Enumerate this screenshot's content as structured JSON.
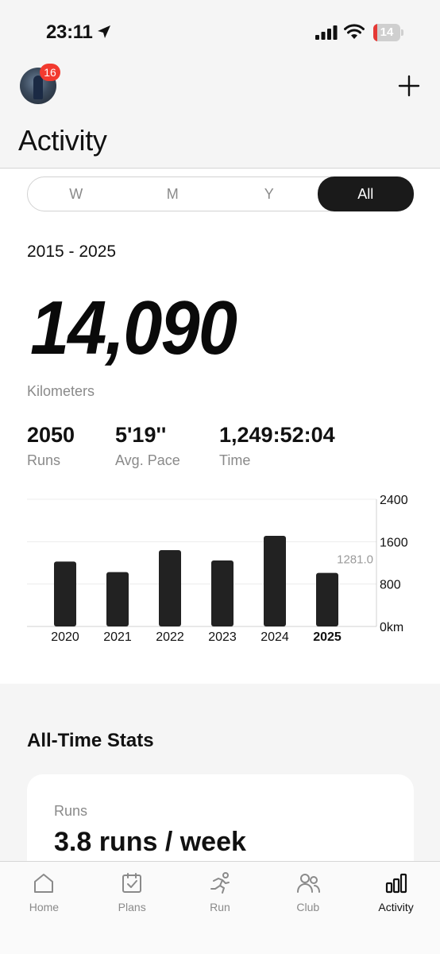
{
  "status": {
    "time": "23:11",
    "battery": "14",
    "battery_level": 0.14
  },
  "header": {
    "badge": "16",
    "title": "Activity"
  },
  "segments": [
    "W",
    "M",
    "Y",
    "All"
  ],
  "summary": {
    "range": "2015 - 2025",
    "distance": "14,090",
    "distance_unit": "Kilometers",
    "stats": [
      {
        "value": "2050",
        "label": "Runs"
      },
      {
        "value": "5'19''",
        "label": "Avg. Pace"
      },
      {
        "value": "1,249:52:04",
        "label": "Time"
      }
    ]
  },
  "chart_data": {
    "type": "bar",
    "categories": [
      "2020",
      "2021",
      "2022",
      "2023",
      "2024",
      "2025"
    ],
    "values": [
      1225,
      1025,
      1440,
      1245,
      1710,
      1010
    ],
    "ylim": [
      0,
      2400
    ],
    "yticks": [
      "0km",
      "800",
      "1600",
      "2400"
    ],
    "reference_line": {
      "value": 1281.0,
      "label": "1281.0"
    },
    "highlight_category": "2025"
  },
  "all_time": {
    "title": "All-Time Stats",
    "card": {
      "label": "Runs",
      "value": "3.8 runs / week"
    }
  },
  "tabs": [
    {
      "label": "Home",
      "icon": "home-icon"
    },
    {
      "label": "Plans",
      "icon": "plans-icon"
    },
    {
      "label": "Run",
      "icon": "run-icon"
    },
    {
      "label": "Club",
      "icon": "club-icon"
    },
    {
      "label": "Activity",
      "icon": "activity-icon",
      "active": true
    }
  ]
}
